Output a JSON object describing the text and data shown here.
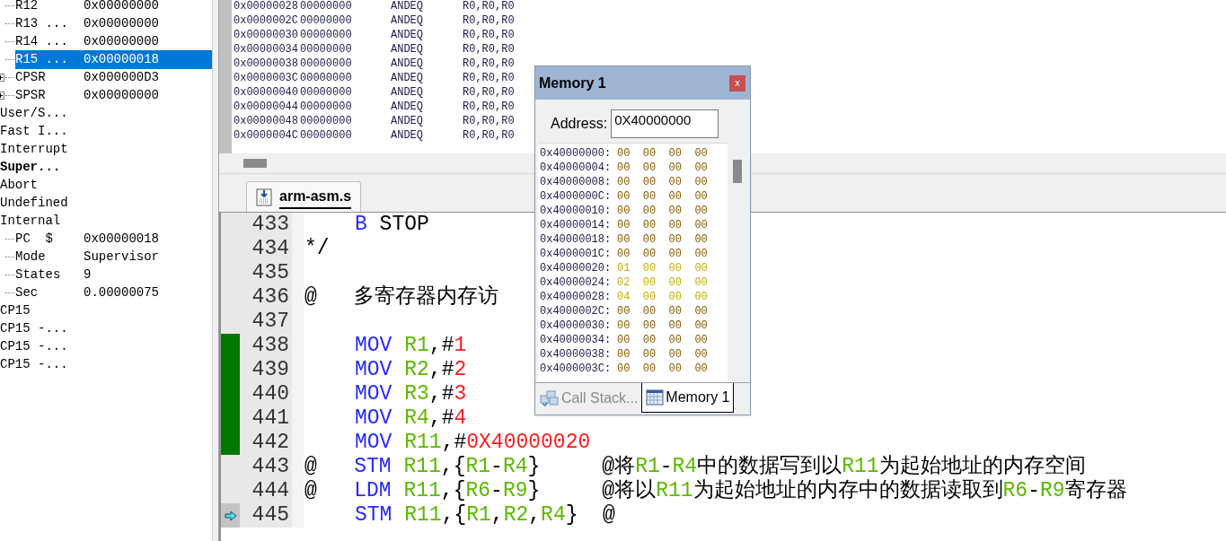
{
  "registers": {
    "items": [
      {
        "children": [
          {
            "name": "R12",
            "value": "0x00000000",
            "selected": false
          },
          {
            "name": "R13 ...",
            "value": "0x00000000",
            "selected": false
          },
          {
            "name": "R14 ...",
            "value": "0x00000000",
            "selected": false
          },
          {
            "name": "R15 ...",
            "value": "0x00000018",
            "selected": true
          },
          {
            "name": "CPSR",
            "value": "0x000000D3",
            "selected": false,
            "expanded": false
          },
          {
            "name": "SPSR",
            "value": "0x00000000",
            "selected": false,
            "expanded": false
          }
        ]
      },
      {
        "name": "User/S...",
        "selected": false,
        "current": false
      },
      {
        "name": "Fast I...",
        "selected": false,
        "current": false
      },
      {
        "name": "Interrupt",
        "selected": false,
        "current": false
      },
      {
        "name": "Super...",
        "selected": false,
        "current": true
      },
      {
        "name": "Abort",
        "selected": false,
        "current": false
      },
      {
        "name": "Undefined",
        "selected": false,
        "current": false
      },
      {
        "name": "Internal",
        "selected": false,
        "current": false,
        "children": [
          {
            "name": "PC  $",
            "value": "0x00000018",
            "selected": false
          },
          {
            "name": "Mode",
            "value": "Supervisor",
            "selected": false
          },
          {
            "name": "States",
            "value": "9",
            "selected": false
          },
          {
            "name": "Sec",
            "value": "0.00000075",
            "selected": false
          }
        ]
      },
      {
        "name": "CP15",
        "selected": false,
        "current": false
      },
      {
        "name": "CP15 -...",
        "selected": false,
        "current": false
      },
      {
        "name": "CP15 -...",
        "selected": false,
        "current": false
      },
      {
        "name": "CP15 -...",
        "selected": false,
        "current": false
      }
    ]
  },
  "disassembly": {
    "rows": [
      {
        "address": "0x00000028",
        "opcode": "00000000",
        "mnemonic": "ANDEQ",
        "operands": "R0,R0,R0"
      },
      {
        "address": "0x0000002C",
        "opcode": "00000000",
        "mnemonic": "ANDEQ",
        "operands": "R0,R0,R0"
      },
      {
        "address": "0x00000030",
        "opcode": "00000000",
        "mnemonic": "ANDEQ",
        "operands": "R0,R0,R0"
      },
      {
        "address": "0x00000034",
        "opcode": "00000000",
        "mnemonic": "ANDEQ",
        "operands": "R0,R0,R0"
      },
      {
        "address": "0x00000038",
        "opcode": "00000000",
        "mnemonic": "ANDEQ",
        "operands": "R0,R0,R0"
      },
      {
        "address": "0x0000003C",
        "opcode": "00000000",
        "mnemonic": "ANDEQ",
        "operands": "R0,R0,R0"
      },
      {
        "address": "0x00000040",
        "opcode": "00000000",
        "mnemonic": "ANDEQ",
        "operands": "R0,R0,R0"
      },
      {
        "address": "0x00000044",
        "opcode": "00000000",
        "mnemonic": "ANDEQ",
        "operands": "R0,R0,R0"
      },
      {
        "address": "0x00000048",
        "opcode": "00000000",
        "mnemonic": "ANDEQ",
        "operands": "R0,R0,R0"
      },
      {
        "address": "0x0000004C",
        "opcode": "00000000",
        "mnemonic": "ANDEQ",
        "operands": "R0,R0,R0"
      }
    ]
  },
  "editor": {
    "tabs": [
      {
        "label": "arm-asm.s",
        "selected": true
      }
    ],
    "lines": [
      {
        "number": "433",
        "executed": false,
        "current": false,
        "indented": true,
        "segments": [
          {
            "kind": "keyword",
            "text": "B"
          },
          {
            "kind": "plain",
            "text": " STOP"
          }
        ]
      },
      {
        "number": "434",
        "executed": false,
        "current": false,
        "indented": false,
        "segments": [
          {
            "kind": "plain",
            "text": "*/"
          }
        ]
      },
      {
        "number": "435",
        "executed": false,
        "current": false
      },
      {
        "number": "436",
        "executed": false,
        "current": false,
        "indented": false,
        "segments": [
          {
            "kind": "plain",
            "text": "@   多寄存器内存访"
          }
        ]
      },
      {
        "number": "437",
        "executed": false,
        "current": false
      },
      {
        "number": "438",
        "executed": true,
        "current": false,
        "indented": true,
        "segments": [
          {
            "kind": "keyword",
            "text": "MOV "
          },
          {
            "kind": "register",
            "text": "R1"
          },
          {
            "kind": "plain",
            "text": ",#"
          },
          {
            "kind": "number",
            "text": "1"
          }
        ]
      },
      {
        "number": "439",
        "executed": true,
        "current": false,
        "indented": true,
        "segments": [
          {
            "kind": "keyword",
            "text": "MOV "
          },
          {
            "kind": "register",
            "text": "R2"
          },
          {
            "kind": "plain",
            "text": ",#"
          },
          {
            "kind": "number",
            "text": "2"
          }
        ]
      },
      {
        "number": "440",
        "executed": true,
        "current": false,
        "indented": true,
        "segments": [
          {
            "kind": "keyword",
            "text": "MOV "
          },
          {
            "kind": "register",
            "text": "R3"
          },
          {
            "kind": "plain",
            "text": ",#"
          },
          {
            "kind": "number",
            "text": "3"
          }
        ]
      },
      {
        "number": "441",
        "executed": true,
        "current": false,
        "indented": true,
        "segments": [
          {
            "kind": "keyword",
            "text": "MOV "
          },
          {
            "kind": "register",
            "text": "R4"
          },
          {
            "kind": "plain",
            "text": ",#"
          },
          {
            "kind": "number",
            "text": "4"
          }
        ]
      },
      {
        "number": "442",
        "executed": true,
        "current": false,
        "indented": true,
        "segments": [
          {
            "kind": "keyword",
            "text": "MOV "
          },
          {
            "kind": "register",
            "text": "R11"
          },
          {
            "kind": "plain",
            "text": ",#"
          },
          {
            "kind": "number",
            "text": "0X40000020"
          }
        ]
      },
      {
        "number": "443",
        "executed": false,
        "current": false,
        "indented": false,
        "segments": [
          {
            "kind": "plain",
            "text": "@   "
          },
          {
            "kind": "keyword",
            "text": "STM "
          },
          {
            "kind": "register",
            "text": "R11"
          },
          {
            "kind": "plain",
            "text": ",{"
          },
          {
            "kind": "register",
            "text": "R1"
          },
          {
            "kind": "plain",
            "text": "-"
          },
          {
            "kind": "register",
            "text": "R4"
          },
          {
            "kind": "plain",
            "text": "}     @将"
          },
          {
            "kind": "register",
            "text": "R1"
          },
          {
            "kind": "plain",
            "text": "-"
          },
          {
            "kind": "register",
            "text": "R4"
          },
          {
            "kind": "plain",
            "text": "中的数据写到以"
          },
          {
            "kind": "register",
            "text": "R11"
          },
          {
            "kind": "plain",
            "text": "为起始地址的内存空间"
          }
        ]
      },
      {
        "number": "444",
        "executed": false,
        "current": false,
        "indented": false,
        "segments": [
          {
            "kind": "plain",
            "text": "@   "
          },
          {
            "kind": "keyword",
            "text": "LDM "
          },
          {
            "kind": "register",
            "text": "R11"
          },
          {
            "kind": "plain",
            "text": ",{"
          },
          {
            "kind": "register",
            "text": "R6"
          },
          {
            "kind": "plain",
            "text": "-"
          },
          {
            "kind": "register",
            "text": "R9"
          },
          {
            "kind": "plain",
            "text": "}     @将以"
          },
          {
            "kind": "register",
            "text": "R11"
          },
          {
            "kind": "plain",
            "text": "为起始地址的内存中的数据读取到"
          },
          {
            "kind": "register",
            "text": "R6"
          },
          {
            "kind": "plain",
            "text": "-"
          },
          {
            "kind": "register",
            "text": "R9"
          },
          {
            "kind": "plain",
            "text": "寄存器"
          }
        ]
      },
      {
        "number": "445",
        "executed": false,
        "current": true,
        "indented": true,
        "segments": [
          {
            "kind": "keyword",
            "text": "STM "
          },
          {
            "kind": "register",
            "text": "R11"
          },
          {
            "kind": "plain",
            "text": ",{"
          },
          {
            "kind": "register",
            "text": "R1"
          },
          {
            "kind": "plain",
            "text": ","
          },
          {
            "kind": "register",
            "text": "R2"
          },
          {
            "kind": "plain",
            "text": ","
          },
          {
            "kind": "register",
            "text": "R4"
          },
          {
            "kind": "plain",
            "text": "}  @"
          }
        ]
      }
    ]
  },
  "memory_window": {
    "title": "Memory 1",
    "close": "x",
    "address_label": "Address:",
    "address_value": "0X40000000",
    "rows": [
      {
        "address": "0x40000000:",
        "bytes": [
          "00",
          "00",
          "00",
          "00"
        ],
        "changed": false
      },
      {
        "address": "0x40000004:",
        "bytes": [
          "00",
          "00",
          "00",
          "00"
        ],
        "changed": false
      },
      {
        "address": "0x40000008:",
        "bytes": [
          "00",
          "00",
          "00",
          "00"
        ],
        "changed": false
      },
      {
        "address": "0x4000000C:",
        "bytes": [
          "00",
          "00",
          "00",
          "00"
        ],
        "changed": false
      },
      {
        "address": "0x40000010:",
        "bytes": [
          "00",
          "00",
          "00",
          "00"
        ],
        "changed": false
      },
      {
        "address": "0x40000014:",
        "bytes": [
          "00",
          "00",
          "00",
          "00"
        ],
        "changed": false
      },
      {
        "address": "0x40000018:",
        "bytes": [
          "00",
          "00",
          "00",
          "00"
        ],
        "changed": false
      },
      {
        "address": "0x4000001C:",
        "bytes": [
          "00",
          "00",
          "00",
          "00"
        ],
        "changed": false
      },
      {
        "address": "0x40000020:",
        "bytes": [
          "01",
          "00",
          "00",
          "00"
        ],
        "changed": true
      },
      {
        "address": "0x40000024:",
        "bytes": [
          "02",
          "00",
          "00",
          "00"
        ],
        "changed": true
      },
      {
        "address": "0x40000028:",
        "bytes": [
          "04",
          "00",
          "00",
          "00"
        ],
        "changed": true
      },
      {
        "address": "0x4000002C:",
        "bytes": [
          "00",
          "00",
          "00",
          "00"
        ],
        "changed": false
      },
      {
        "address": "0x40000030:",
        "bytes": [
          "00",
          "00",
          "00",
          "00"
        ],
        "changed": false
      },
      {
        "address": "0x40000034:",
        "bytes": [
          "00",
          "00",
          "00",
          "00"
        ],
        "changed": false
      },
      {
        "address": "0x40000038:",
        "bytes": [
          "00",
          "00",
          "00",
          "00"
        ],
        "changed": false
      },
      {
        "address": "0x4000003C:",
        "bytes": [
          "00",
          "00",
          "00",
          "00"
        ],
        "changed": false
      }
    ],
    "tabs": [
      {
        "label": "Call Stack...",
        "kind": "callstack",
        "selected": false
      },
      {
        "label": "Memory 1",
        "kind": "memory",
        "selected": true
      }
    ]
  }
}
